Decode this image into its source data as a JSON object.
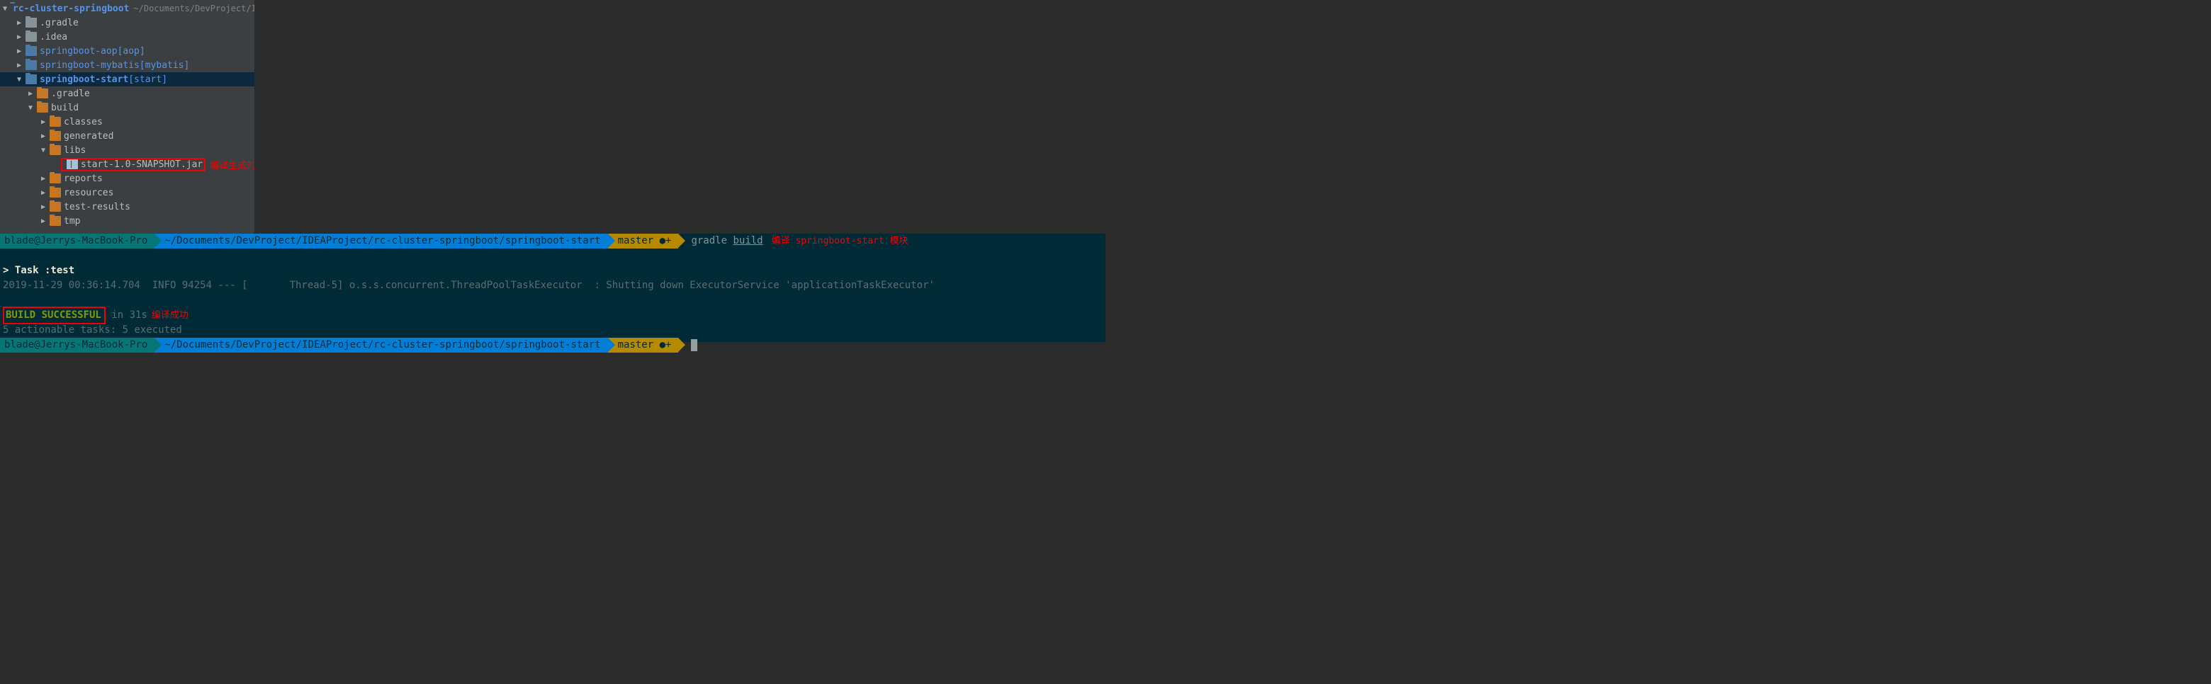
{
  "tree": {
    "root": {
      "name": "rc-cluster-springboot",
      "path": "~/Documents/DevProject/IDEAP"
    },
    "items": [
      {
        "name": ".gradle",
        "indent": 1,
        "arrow": "▶",
        "icon": "gray"
      },
      {
        "name": ".idea",
        "indent": 1,
        "arrow": "▶",
        "icon": "gray"
      },
      {
        "name": "springboot-aop",
        "bracket": "[aop]",
        "indent": 1,
        "arrow": "▶",
        "icon": "module",
        "link": true
      },
      {
        "name": "springboot-mybatis",
        "bracket": "[mybatis]",
        "indent": 1,
        "arrow": "▶",
        "icon": "module",
        "link": true
      },
      {
        "name": "springboot-start",
        "bracket": "[start]",
        "indent": 1,
        "arrow": "▼",
        "icon": "module",
        "link": true,
        "bold": true,
        "selected": true
      },
      {
        "name": ".gradle",
        "indent": 2,
        "arrow": "▶",
        "icon": "orange"
      },
      {
        "name": "build",
        "indent": 2,
        "arrow": "▼",
        "icon": "orange"
      },
      {
        "name": "classes",
        "indent": 3,
        "arrow": "▶",
        "icon": "orange"
      },
      {
        "name": "generated",
        "indent": 3,
        "arrow": "▶",
        "icon": "orange"
      },
      {
        "name": "libs",
        "indent": 3,
        "arrow": "▼",
        "icon": "orange"
      },
      {
        "name": "start-1.0-SNAPSHOT.jar",
        "indent": 5,
        "icon": "jar",
        "boxed": true,
        "annotation": "编译生成的 jar 文件"
      },
      {
        "name": "reports",
        "indent": 3,
        "arrow": "▶",
        "icon": "orange"
      },
      {
        "name": "resources",
        "indent": 3,
        "arrow": "▶",
        "icon": "orange"
      },
      {
        "name": "test-results",
        "indent": 3,
        "arrow": "▶",
        "icon": "orange"
      },
      {
        "name": "tmp",
        "indent": 3,
        "arrow": "▶",
        "icon": "orange"
      }
    ]
  },
  "terminal": {
    "prompt1": {
      "user": "blade@Jerrys-MacBook-Pro",
      "path": "~/Documents/DevProject/IDEAProject/rc-cluster-springboot/springboot-start",
      "branch": "master ●+",
      "cmd_bin": "gradle",
      "cmd_arg": "build",
      "annotation": "编译 springboot-start 模块"
    },
    "task_line": "> Task :test",
    "log_line": "2019-11-29 00:36:14.704  INFO 94254 --- [       Thread-5] o.s.s.concurrent.ThreadPoolTaskExecutor  : Shutting down ExecutorService 'applicationTaskExecutor'",
    "build_status": "BUILD SUCCESSFUL",
    "build_time": " in 31s",
    "build_annotation": "编译成功",
    "tasks_line": "5 actionable tasks: 5 executed",
    "prompt2": {
      "user": "blade@Jerrys-MacBook-Pro",
      "path": "~/Documents/DevProject/IDEAProject/rc-cluster-springboot/springboot-start",
      "branch": "master ●+"
    }
  }
}
